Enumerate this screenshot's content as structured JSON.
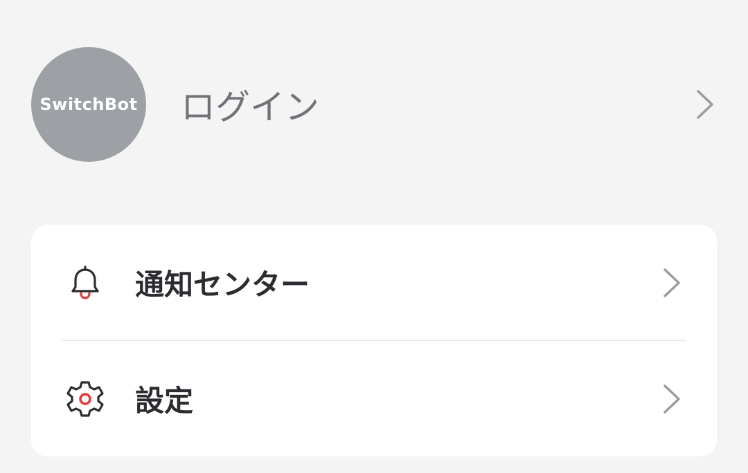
{
  "profile": {
    "avatar_text": "SwitchBot",
    "login_label": "ログイン",
    "chevron_icon": "chevron-right-icon"
  },
  "menu": {
    "items": [
      {
        "label": "通知センター",
        "icon": "bell-icon",
        "chevron_icon": "chevron-right-icon"
      },
      {
        "label": "設定",
        "icon": "gear-icon",
        "chevron_icon": "chevron-right-icon"
      }
    ]
  },
  "colors": {
    "background": "#f4f4f5",
    "avatar": "#9da0a4",
    "accent_red": "#e5383b",
    "text_dark": "#2a2c30",
    "text_muted": "#6f7276",
    "chevron": "#9a9ca0"
  }
}
